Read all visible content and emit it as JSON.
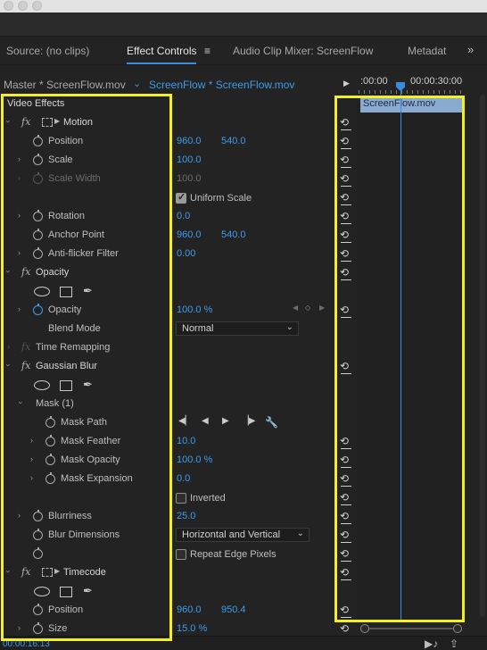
{
  "tabs": {
    "source": "Source: (no clips)",
    "effect_controls": "Effect Controls",
    "audio_mixer": "Audio Clip Mixer: ScreenFlow",
    "metadata": "Metadat",
    "menu_glyph": "≡",
    "overflow_glyph": "»"
  },
  "clip_bar": {
    "master": "Master * ScreenFlow.mov",
    "chevron": "⌄",
    "clip": "ScreenFlow * ScreenFlow.mov",
    "play": "▶"
  },
  "ruler": {
    "t0": ":00:00",
    "t1": "00:00:30:00"
  },
  "timeline_clip": "ScreenFlow.mov",
  "rows": {
    "video_effects": "Video Effects",
    "motion": "Motion",
    "position": {
      "label": "Position",
      "x": "960.0",
      "y": "540.0"
    },
    "scale": {
      "label": "Scale",
      "value": "100.0"
    },
    "scale_width": {
      "label": "Scale Width",
      "value": "100.0"
    },
    "uniform_scale": {
      "label": "Uniform Scale",
      "checked": true
    },
    "rotation": {
      "label": "Rotation",
      "value": "0.0"
    },
    "anchor_point": {
      "label": "Anchor Point",
      "x": "960.0",
      "y": "540.0"
    },
    "anti_flicker": {
      "label": "Anti-flicker Filter",
      "value": "0.00"
    },
    "opacity_fx": "Opacity",
    "opacity": {
      "label": "Opacity",
      "value": "100.0 %"
    },
    "blend_mode": {
      "label": "Blend Mode",
      "value": "Normal"
    },
    "time_remapping": "Time Remapping",
    "gaussian_blur": "Gaussian Blur",
    "mask": "Mask (1)",
    "mask_path": "Mask Path",
    "mask_feather": {
      "label": "Mask Feather",
      "value": "10.0"
    },
    "mask_opacity": {
      "label": "Mask Opacity",
      "value": "100.0 %"
    },
    "mask_expansion": {
      "label": "Mask Expansion",
      "value": "0.0"
    },
    "inverted": {
      "label": "Inverted",
      "checked": false
    },
    "blurriness": {
      "label": "Blurriness",
      "value": "25.0"
    },
    "blur_dimensions": {
      "label": "Blur Dimensions",
      "value": "Horizontal and Vertical"
    },
    "repeat_edge": {
      "label": "Repeat Edge Pixels",
      "checked": false
    },
    "timecode": "Timecode",
    "tc_position": {
      "label": "Position",
      "x": "960.0",
      "y": "950.4"
    },
    "size": {
      "label": "Size",
      "value": "15.0 %"
    }
  },
  "footer": {
    "timecode": "00:00:16:13"
  },
  "colors": {
    "accent": "#3f9ceb",
    "highlight": "#f4f020",
    "clip": "#8aaad0"
  },
  "icons": [
    "fx-icon",
    "stopwatch-icon",
    "reset-icon",
    "transform-icon",
    "ellipse-mask-icon",
    "rect-mask-icon",
    "pen-mask-icon",
    "twirl-icon"
  ]
}
